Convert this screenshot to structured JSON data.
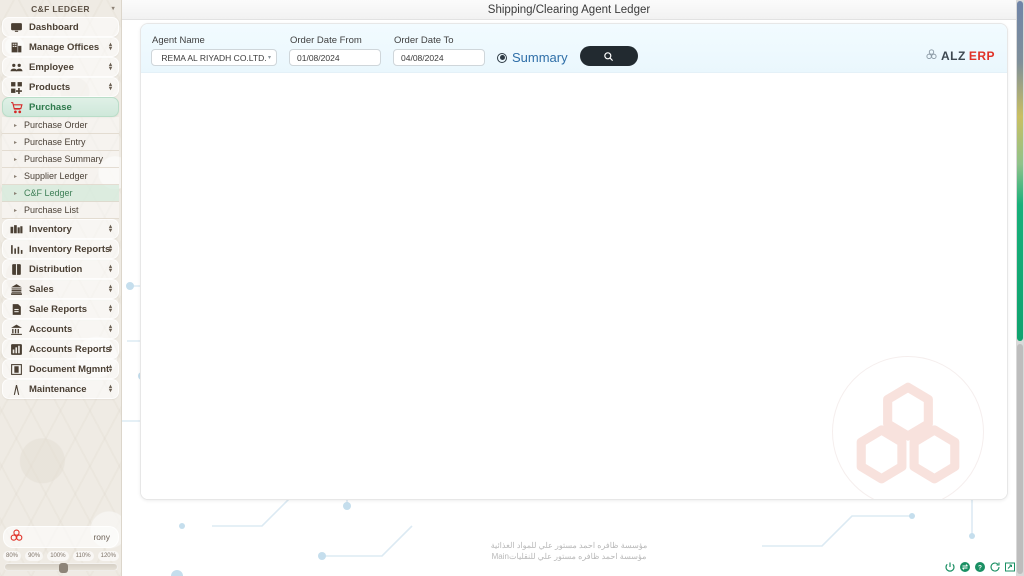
{
  "window": {
    "title": "Shipping/Clearing Agent Ledger"
  },
  "sidebar": {
    "header": {
      "label": "C&F LEDGER",
      "caret": "▾"
    },
    "items": [
      {
        "label": "Dashboard",
        "icon": "monitor-icon",
        "expandable": false
      },
      {
        "label": "Manage Offices",
        "icon": "building-icon",
        "expandable": true
      },
      {
        "label": "Employee",
        "icon": "people-icon",
        "expandable": true
      },
      {
        "label": "Products",
        "icon": "grid-plus-icon",
        "expandable": true
      },
      {
        "label": "Purchase",
        "icon": "shopping-cart-icon",
        "expandable": false,
        "active": true
      }
    ],
    "subitems": [
      {
        "label": "Purchase Order",
        "active": false
      },
      {
        "label": "Purchase Entry",
        "active": false
      },
      {
        "label": "Purchase Summary",
        "active": false
      },
      {
        "label": "Supplier Ledger",
        "active": false
      },
      {
        "label": "C&F Ledger",
        "active": true
      },
      {
        "label": "Purchase List",
        "active": false
      }
    ],
    "items2": [
      {
        "label": "Inventory",
        "icon": "boxes-icon",
        "expandable": true
      },
      {
        "label": "Inventory Reports",
        "icon": "bar-chart-icon",
        "expandable": true
      },
      {
        "label": "Distribution",
        "icon": "book-icon",
        "expandable": true
      },
      {
        "label": "Sales",
        "icon": "bank-icon",
        "expandable": true
      },
      {
        "label": "Sale Reports",
        "icon": "document-icon",
        "expandable": true
      },
      {
        "label": "Accounts",
        "icon": "bank-columns-icon",
        "expandable": true
      },
      {
        "label": "Accounts Reports",
        "icon": "chart-report-icon",
        "expandable": true
      },
      {
        "label": "Document Mgmnt",
        "icon": "document-box-icon",
        "expandable": true
      },
      {
        "label": "Maintenance",
        "icon": "wrench-icon",
        "expandable": true
      }
    ],
    "user": {
      "name": "rony",
      "logo": "trefoil-logo-icon"
    },
    "zoom": {
      "levels": [
        "80%",
        "90%",
        "100%",
        "110%",
        "120%"
      ],
      "current": "100%"
    }
  },
  "filters": {
    "agent_name": {
      "label": "Agent Name",
      "value": "REMA AL RIYADH CO.LTD.",
      "caret": "▾"
    },
    "order_date_from": {
      "label": "Order Date From",
      "value": "01/08/2024"
    },
    "order_date_to": {
      "label": "Order Date To",
      "value": "04/08/2024"
    },
    "summary_radio": {
      "label": "Summary",
      "selected": true
    },
    "search_button": {
      "icon": "search-icon"
    }
  },
  "brand": {
    "part1": "ALZ",
    "part2": "ERP",
    "mark": "trefoil-logo-icon"
  },
  "footer": {
    "line1": "مؤسسة ظافره احمد مستور علي للمواد الغذائية",
    "line2": "مؤسسة احمد ظافره مستور علي للنقليات",
    "line2_suffix": "Main"
  },
  "status_icons": [
    {
      "name": "power-icon"
    },
    {
      "name": "exchange-icon"
    },
    {
      "name": "help-icon"
    },
    {
      "name": "refresh-icon"
    },
    {
      "name": "fullscreen-icon"
    }
  ],
  "colors": {
    "accent_green": "#18996b",
    "brand_red": "#e03127",
    "link_blue": "#2f6fa8",
    "panel_blue": "#eaf7fd",
    "sidebar_beige": "#efece6"
  }
}
